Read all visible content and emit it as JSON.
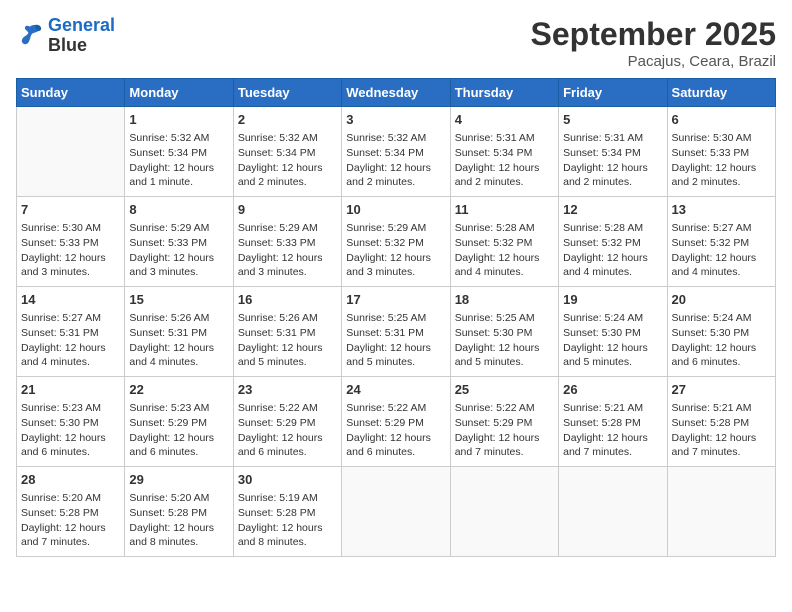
{
  "logo": {
    "line1": "General",
    "line2": "Blue"
  },
  "title": "September 2025",
  "location": "Pacajus, Ceara, Brazil",
  "days_of_week": [
    "Sunday",
    "Monday",
    "Tuesday",
    "Wednesday",
    "Thursday",
    "Friday",
    "Saturday"
  ],
  "weeks": [
    [
      {
        "num": "",
        "info": ""
      },
      {
        "num": "1",
        "info": "Sunrise: 5:32 AM\nSunset: 5:34 PM\nDaylight: 12 hours\nand 1 minute."
      },
      {
        "num": "2",
        "info": "Sunrise: 5:32 AM\nSunset: 5:34 PM\nDaylight: 12 hours\nand 2 minutes."
      },
      {
        "num": "3",
        "info": "Sunrise: 5:32 AM\nSunset: 5:34 PM\nDaylight: 12 hours\nand 2 minutes."
      },
      {
        "num": "4",
        "info": "Sunrise: 5:31 AM\nSunset: 5:34 PM\nDaylight: 12 hours\nand 2 minutes."
      },
      {
        "num": "5",
        "info": "Sunrise: 5:31 AM\nSunset: 5:34 PM\nDaylight: 12 hours\nand 2 minutes."
      },
      {
        "num": "6",
        "info": "Sunrise: 5:30 AM\nSunset: 5:33 PM\nDaylight: 12 hours\nand 2 minutes."
      }
    ],
    [
      {
        "num": "7",
        "info": "Sunrise: 5:30 AM\nSunset: 5:33 PM\nDaylight: 12 hours\nand 3 minutes."
      },
      {
        "num": "8",
        "info": "Sunrise: 5:29 AM\nSunset: 5:33 PM\nDaylight: 12 hours\nand 3 minutes."
      },
      {
        "num": "9",
        "info": "Sunrise: 5:29 AM\nSunset: 5:33 PM\nDaylight: 12 hours\nand 3 minutes."
      },
      {
        "num": "10",
        "info": "Sunrise: 5:29 AM\nSunset: 5:32 PM\nDaylight: 12 hours\nand 3 minutes."
      },
      {
        "num": "11",
        "info": "Sunrise: 5:28 AM\nSunset: 5:32 PM\nDaylight: 12 hours\nand 4 minutes."
      },
      {
        "num": "12",
        "info": "Sunrise: 5:28 AM\nSunset: 5:32 PM\nDaylight: 12 hours\nand 4 minutes."
      },
      {
        "num": "13",
        "info": "Sunrise: 5:27 AM\nSunset: 5:32 PM\nDaylight: 12 hours\nand 4 minutes."
      }
    ],
    [
      {
        "num": "14",
        "info": "Sunrise: 5:27 AM\nSunset: 5:31 PM\nDaylight: 12 hours\nand 4 minutes."
      },
      {
        "num": "15",
        "info": "Sunrise: 5:26 AM\nSunset: 5:31 PM\nDaylight: 12 hours\nand 4 minutes."
      },
      {
        "num": "16",
        "info": "Sunrise: 5:26 AM\nSunset: 5:31 PM\nDaylight: 12 hours\nand 5 minutes."
      },
      {
        "num": "17",
        "info": "Sunrise: 5:25 AM\nSunset: 5:31 PM\nDaylight: 12 hours\nand 5 minutes."
      },
      {
        "num": "18",
        "info": "Sunrise: 5:25 AM\nSunset: 5:30 PM\nDaylight: 12 hours\nand 5 minutes."
      },
      {
        "num": "19",
        "info": "Sunrise: 5:24 AM\nSunset: 5:30 PM\nDaylight: 12 hours\nand 5 minutes."
      },
      {
        "num": "20",
        "info": "Sunrise: 5:24 AM\nSunset: 5:30 PM\nDaylight: 12 hours\nand 6 minutes."
      }
    ],
    [
      {
        "num": "21",
        "info": "Sunrise: 5:23 AM\nSunset: 5:30 PM\nDaylight: 12 hours\nand 6 minutes."
      },
      {
        "num": "22",
        "info": "Sunrise: 5:23 AM\nSunset: 5:29 PM\nDaylight: 12 hours\nand 6 minutes."
      },
      {
        "num": "23",
        "info": "Sunrise: 5:22 AM\nSunset: 5:29 PM\nDaylight: 12 hours\nand 6 minutes."
      },
      {
        "num": "24",
        "info": "Sunrise: 5:22 AM\nSunset: 5:29 PM\nDaylight: 12 hours\nand 6 minutes."
      },
      {
        "num": "25",
        "info": "Sunrise: 5:22 AM\nSunset: 5:29 PM\nDaylight: 12 hours\nand 7 minutes."
      },
      {
        "num": "26",
        "info": "Sunrise: 5:21 AM\nSunset: 5:28 PM\nDaylight: 12 hours\nand 7 minutes."
      },
      {
        "num": "27",
        "info": "Sunrise: 5:21 AM\nSunset: 5:28 PM\nDaylight: 12 hours\nand 7 minutes."
      }
    ],
    [
      {
        "num": "28",
        "info": "Sunrise: 5:20 AM\nSunset: 5:28 PM\nDaylight: 12 hours\nand 7 minutes."
      },
      {
        "num": "29",
        "info": "Sunrise: 5:20 AM\nSunset: 5:28 PM\nDaylight: 12 hours\nand 8 minutes."
      },
      {
        "num": "30",
        "info": "Sunrise: 5:19 AM\nSunset: 5:28 PM\nDaylight: 12 hours\nand 8 minutes."
      },
      {
        "num": "",
        "info": ""
      },
      {
        "num": "",
        "info": ""
      },
      {
        "num": "",
        "info": ""
      },
      {
        "num": "",
        "info": ""
      }
    ]
  ]
}
